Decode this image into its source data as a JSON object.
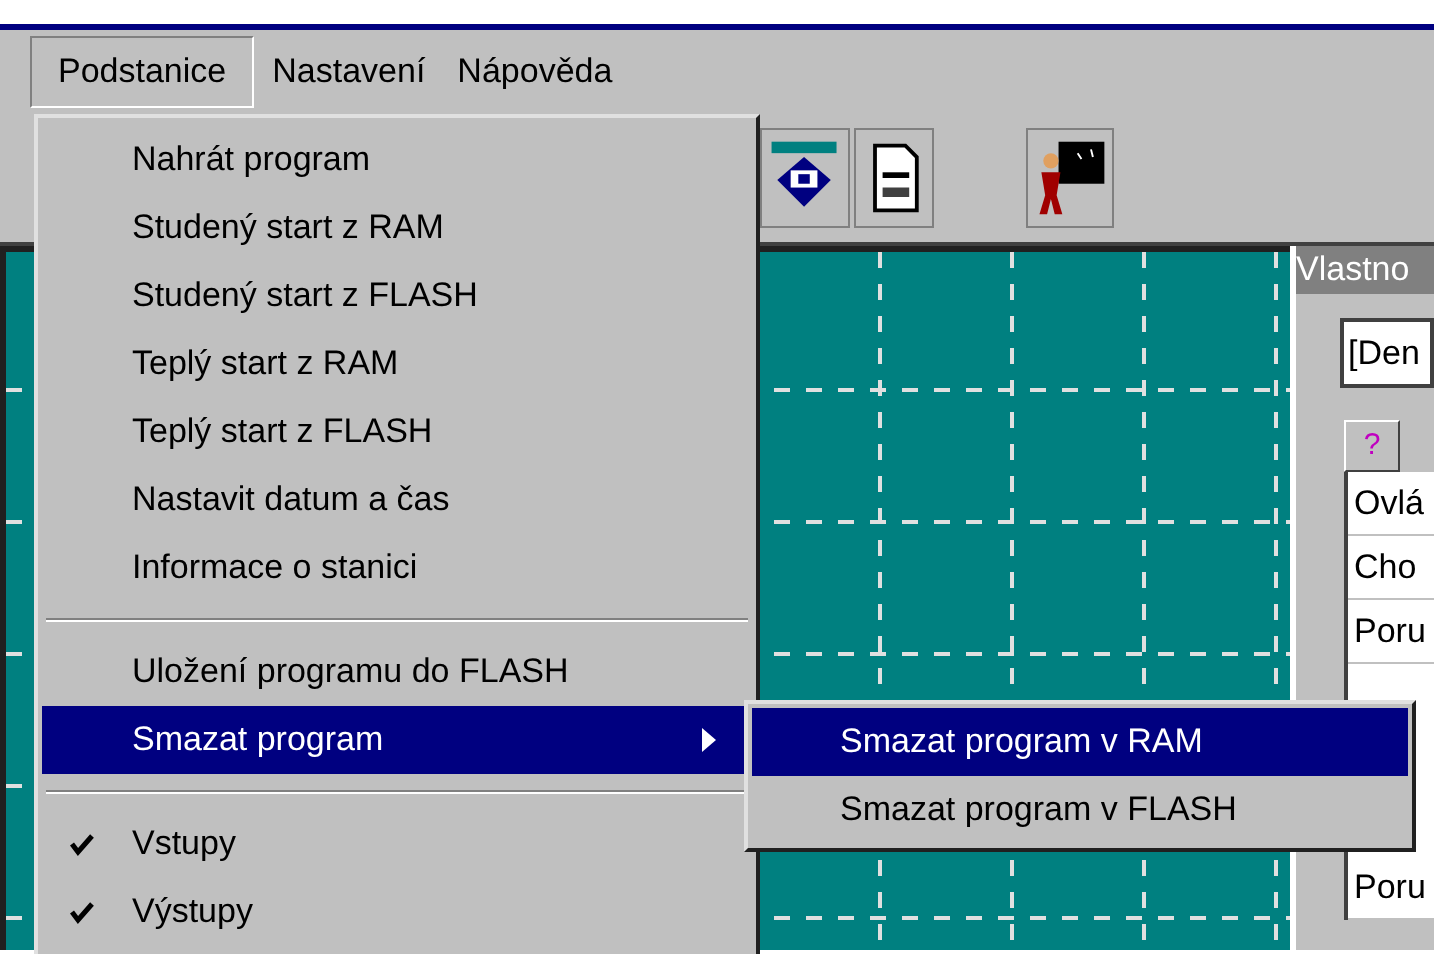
{
  "menubar": [
    {
      "label": "Podstanice",
      "selected": true
    },
    {
      "label": "Nastavení",
      "selected": false
    },
    {
      "label": "Nápověda",
      "selected": false
    }
  ],
  "menu": {
    "items": [
      {
        "kind": "item",
        "label": "Nahrát program",
        "checked": false,
        "selected": false,
        "submenu": false
      },
      {
        "kind": "item",
        "label": "Studený start z RAM",
        "checked": false,
        "selected": false,
        "submenu": false
      },
      {
        "kind": "item",
        "label": "Studený start z FLASH",
        "checked": false,
        "selected": false,
        "submenu": false
      },
      {
        "kind": "item",
        "label": "Teplý start z RAM",
        "checked": false,
        "selected": false,
        "submenu": false
      },
      {
        "kind": "item",
        "label": "Teplý start z FLASH",
        "checked": false,
        "selected": false,
        "submenu": false
      },
      {
        "kind": "item",
        "label": "Nastavit datum a čas",
        "checked": false,
        "selected": false,
        "submenu": false
      },
      {
        "kind": "item",
        "label": "Informace o stanici",
        "checked": false,
        "selected": false,
        "submenu": false
      },
      {
        "kind": "separator"
      },
      {
        "kind": "item",
        "label": "Uložení programu do FLASH",
        "checked": false,
        "selected": false,
        "submenu": false
      },
      {
        "kind": "item",
        "label": "Smazat program",
        "checked": false,
        "selected": true,
        "submenu": true
      },
      {
        "kind": "separator"
      },
      {
        "kind": "item",
        "label": "Vstupy",
        "checked": true,
        "selected": false,
        "submenu": false
      },
      {
        "kind": "item",
        "label": "Výstupy",
        "checked": true,
        "selected": false,
        "submenu": false
      }
    ]
  },
  "submenu": {
    "items": [
      {
        "label": "Smazat program v RAM",
        "selected": true
      },
      {
        "label": "Smazat program v FLASH",
        "selected": false
      }
    ]
  },
  "properties_panel": {
    "title": "Vlastno",
    "dropdown_value": "[Den",
    "tab": "?",
    "rows_top": [
      "Ovlá",
      "Cho",
      "Poru"
    ],
    "rows_bottom": [
      "Poru"
    ]
  }
}
